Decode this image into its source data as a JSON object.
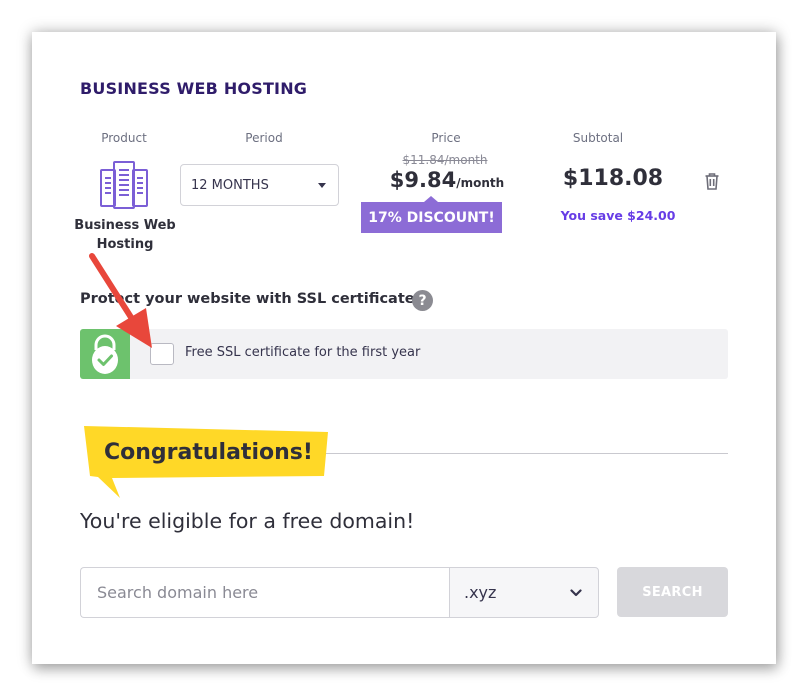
{
  "plan": {
    "title": "BUSINESS WEB HOSTING",
    "columns": {
      "product": "Product",
      "period": "Period",
      "price": "Price",
      "subtotal": "Subtotal"
    },
    "product_name": "Business Web Hosting",
    "product_icon": "server-rack-icon",
    "period_value": "12 MONTHS",
    "old_price": "$11.84/month",
    "new_price_amount": "$9.84",
    "new_price_unit": "/month",
    "discount": "17% DISCOUNT!",
    "subtotal_value": "$118.08",
    "savings": "You save $24.00",
    "delete_icon": "trash-icon"
  },
  "ssl": {
    "heading": "Protect your website with SSL certificate",
    "help_icon": "?",
    "option_label": "Free SSL certificate for the first year",
    "checked": false,
    "badge_icon": "lock-check-icon"
  },
  "promo": {
    "congrats": "Congratulations!",
    "eligible": "You're eligible for a free domain!"
  },
  "domain_search": {
    "placeholder": "Search domain here",
    "tld": ".xyz",
    "button": "SEARCH"
  },
  "colors": {
    "accent_purple": "#673de6",
    "badge_purple": "#8c6cd6",
    "ssl_green": "#6dc26d",
    "banner_yellow": "#ffd827",
    "arrow_red": "#e8473b",
    "heading_navy": "#2f1c6a"
  }
}
